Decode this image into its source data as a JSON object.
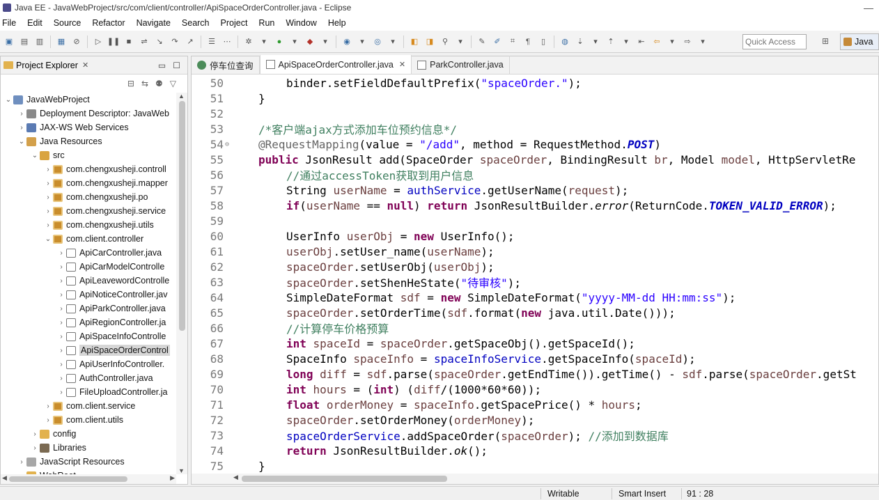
{
  "window": {
    "title": "Java EE - JavaWebProject/src/com/client/controller/ApiSpaceOrderController.java - Eclipse",
    "minimize": "—"
  },
  "menu": [
    "File",
    "Edit",
    "Source",
    "Refactor",
    "Navigate",
    "Search",
    "Project",
    "Run",
    "Window",
    "Help"
  ],
  "toolbar": {
    "quick_access_placeholder": "Quick Access",
    "perspective_label": "Java"
  },
  "explorer": {
    "tab_label": "Project Explorer",
    "tree": [
      {
        "label": "JavaWebProject",
        "twisty": "v",
        "icon": "project"
      },
      {
        "label": "Deployment Descriptor: JavaWeb",
        "twisty": ">",
        "icon": "descriptor"
      },
      {
        "label": "JAX-WS Web Services",
        "twisty": ">",
        "icon": "ws"
      },
      {
        "label": "Java Resources",
        "twisty": "v",
        "icon": "res"
      },
      {
        "label": "src",
        "twisty": "v",
        "icon": "src"
      },
      {
        "label": "com.chengxusheji.controll",
        "twisty": ">",
        "icon": "pkg"
      },
      {
        "label": "com.chengxusheji.mapper",
        "twisty": ">",
        "icon": "pkg"
      },
      {
        "label": "com.chengxusheji.po",
        "twisty": ">",
        "icon": "pkg"
      },
      {
        "label": "com.chengxusheji.service",
        "twisty": ">",
        "icon": "pkg"
      },
      {
        "label": "com.chengxusheji.utils",
        "twisty": ">",
        "icon": "pkg"
      },
      {
        "label": "com.client.controller",
        "twisty": "v",
        "icon": "pkg"
      },
      {
        "label": "ApiCarController.java",
        "twisty": ">",
        "icon": "java"
      },
      {
        "label": "ApiCarModelControlle",
        "twisty": ">",
        "icon": "java"
      },
      {
        "label": "ApiLeavewordControlle",
        "twisty": ">",
        "icon": "java"
      },
      {
        "label": "ApiNoticeController.jav",
        "twisty": ">",
        "icon": "java"
      },
      {
        "label": "ApiParkController.java",
        "twisty": ">",
        "icon": "java"
      },
      {
        "label": "ApiRegionController.ja",
        "twisty": ">",
        "icon": "java"
      },
      {
        "label": "ApiSpaceInfoControlle",
        "twisty": ">",
        "icon": "java"
      },
      {
        "label": "ApiSpaceOrderControl",
        "twisty": ">",
        "icon": "java",
        "selected": true
      },
      {
        "label": "ApiUserInfoController.",
        "twisty": ">",
        "icon": "java"
      },
      {
        "label": "AuthController.java",
        "twisty": ">",
        "icon": "java"
      },
      {
        "label": "FileUploadController.ja",
        "twisty": ">",
        "icon": "java"
      },
      {
        "label": "com.client.service",
        "twisty": ">",
        "icon": "pkg"
      },
      {
        "label": "com.client.utils",
        "twisty": ">",
        "icon": "pkg"
      },
      {
        "label": "config",
        "twisty": ">",
        "icon": "folder"
      },
      {
        "label": "Libraries",
        "twisty": ">",
        "icon": "lib"
      },
      {
        "label": "JavaScript Resources",
        "twisty": ">",
        "icon": "js"
      },
      {
        "label": "WebRoot",
        "twisty": "v",
        "icon": "folder"
      }
    ]
  },
  "editor": {
    "tabs": [
      {
        "label": "停车位查询",
        "icon": "globe",
        "active": false
      },
      {
        "label": "ApiSpaceOrderController.java",
        "icon": "jf",
        "active": true
      },
      {
        "label": "ParkController.java",
        "icon": "jf",
        "active": false
      }
    ],
    "lines": [
      {
        "n": "50",
        "indent": 2,
        "tokens": [
          [
            "binder.setFieldDefaultPrefix(",
            ""
          ],
          [
            "\"spaceOrder.\"",
            "str"
          ],
          [
            ");",
            ""
          ]
        ]
      },
      {
        "n": "51",
        "indent": 1,
        "tokens": [
          [
            "}",
            ""
          ]
        ]
      },
      {
        "n": "52",
        "indent": 0,
        "tokens": []
      },
      {
        "n": "53",
        "indent": 1,
        "tokens": [
          [
            "/*客户端ajax方式添加车位预约信息*/",
            "cm"
          ]
        ]
      },
      {
        "n": "54",
        "indent": 1,
        "fold": true,
        "tokens": [
          [
            "@RequestMapping",
            "ann"
          ],
          [
            "(value = ",
            ""
          ],
          [
            "\"/add\"",
            "str"
          ],
          [
            ", method = RequestMethod.",
            ""
          ],
          [
            "POST",
            "bfld"
          ],
          [
            ")",
            ""
          ]
        ]
      },
      {
        "n": "55",
        "indent": 1,
        "tokens": [
          [
            "public",
            "kw"
          ],
          [
            " JsonResult add(SpaceOrder ",
            ""
          ],
          [
            "spaceOrder",
            "var"
          ],
          [
            ", BindingResult ",
            ""
          ],
          [
            "br",
            "var"
          ],
          [
            ", Model ",
            ""
          ],
          [
            "model",
            "var"
          ],
          [
            ", HttpServletRe",
            ""
          ]
        ]
      },
      {
        "n": "56",
        "indent": 2,
        "tokens": [
          [
            "//通过accessToken获取到用户信息",
            "cm"
          ]
        ]
      },
      {
        "n": "57",
        "indent": 2,
        "tokens": [
          [
            "String ",
            ""
          ],
          [
            "userName",
            "var"
          ],
          [
            " = ",
            ""
          ],
          [
            "authService",
            "fld"
          ],
          [
            ".getUserName(",
            ""
          ],
          [
            "request",
            "var"
          ],
          [
            ");",
            ""
          ]
        ]
      },
      {
        "n": "58",
        "indent": 2,
        "tokens": [
          [
            "if",
            "kw"
          ],
          [
            "(",
            ""
          ],
          [
            "userName",
            "var"
          ],
          [
            " == ",
            ""
          ],
          [
            "null",
            "kw"
          ],
          [
            ") ",
            ""
          ],
          [
            "return",
            "kw"
          ],
          [
            " JsonResultBuilder.",
            ""
          ],
          [
            "error",
            "it"
          ],
          [
            "(ReturnCode.",
            ""
          ],
          [
            "TOKEN_VALID_ERROR",
            "bfld"
          ],
          [
            ");",
            ""
          ]
        ]
      },
      {
        "n": "59",
        "indent": 0,
        "tokens": []
      },
      {
        "n": "60",
        "indent": 2,
        "tokens": [
          [
            "UserInfo ",
            ""
          ],
          [
            "userObj",
            "var"
          ],
          [
            " = ",
            ""
          ],
          [
            "new",
            "kw"
          ],
          [
            " UserInfo();",
            ""
          ]
        ]
      },
      {
        "n": "61",
        "indent": 2,
        "tokens": [
          [
            "userObj",
            "var"
          ],
          [
            ".setUser_name(",
            ""
          ],
          [
            "userName",
            "var"
          ],
          [
            ");",
            ""
          ]
        ]
      },
      {
        "n": "62",
        "indent": 2,
        "tokens": [
          [
            "spaceOrder",
            "var"
          ],
          [
            ".setUserObj(",
            ""
          ],
          [
            "userObj",
            "var"
          ],
          [
            ");",
            ""
          ]
        ]
      },
      {
        "n": "63",
        "indent": 2,
        "tokens": [
          [
            "spaceOrder",
            "var"
          ],
          [
            ".setShenHeState(",
            ""
          ],
          [
            "\"待审核\"",
            "str"
          ],
          [
            ");",
            ""
          ]
        ]
      },
      {
        "n": "64",
        "indent": 2,
        "tokens": [
          [
            "SimpleDateFormat ",
            ""
          ],
          [
            "sdf",
            "var"
          ],
          [
            " = ",
            ""
          ],
          [
            "new",
            "kw"
          ],
          [
            " SimpleDateFormat(",
            ""
          ],
          [
            "\"yyyy-MM-dd HH:mm:ss\"",
            "str"
          ],
          [
            ");",
            ""
          ]
        ]
      },
      {
        "n": "65",
        "indent": 2,
        "tokens": [
          [
            "spaceOrder",
            "var"
          ],
          [
            ".setOrderTime(",
            ""
          ],
          [
            "sdf",
            "var"
          ],
          [
            ".format(",
            ""
          ],
          [
            "new",
            "kw"
          ],
          [
            " java.util.Date()));",
            ""
          ]
        ]
      },
      {
        "n": "66",
        "indent": 2,
        "tokens": [
          [
            "//计算停车价格预算",
            "cm"
          ]
        ]
      },
      {
        "n": "67",
        "indent": 2,
        "tokens": [
          [
            "int",
            "kw"
          ],
          [
            " ",
            ""
          ],
          [
            "spaceId",
            "var"
          ],
          [
            " = ",
            ""
          ],
          [
            "spaceOrder",
            "var"
          ],
          [
            ".getSpaceObj().getSpaceId();",
            ""
          ]
        ]
      },
      {
        "n": "68",
        "indent": 2,
        "tokens": [
          [
            "SpaceInfo ",
            ""
          ],
          [
            "spaceInfo",
            "var"
          ],
          [
            " = ",
            ""
          ],
          [
            "spaceInfoService",
            "fld"
          ],
          [
            ".getSpaceInfo(",
            ""
          ],
          [
            "spaceId",
            "var"
          ],
          [
            ");",
            ""
          ]
        ]
      },
      {
        "n": "69",
        "indent": 2,
        "tokens": [
          [
            "long",
            "kw"
          ],
          [
            " ",
            ""
          ],
          [
            "diff",
            "var"
          ],
          [
            " = ",
            ""
          ],
          [
            "sdf",
            "var"
          ],
          [
            ".parse(",
            ""
          ],
          [
            "spaceOrder",
            "var"
          ],
          [
            ".getEndTime()).getTime() - ",
            ""
          ],
          [
            "sdf",
            "var"
          ],
          [
            ".parse(",
            ""
          ],
          [
            "spaceOrder",
            "var"
          ],
          [
            ".getSt",
            ""
          ]
        ]
      },
      {
        "n": "70",
        "indent": 2,
        "tokens": [
          [
            "int",
            "kw"
          ],
          [
            " ",
            ""
          ],
          [
            "hours",
            "var"
          ],
          [
            " = (",
            ""
          ],
          [
            "int",
            "kw"
          ],
          [
            ") (",
            ""
          ],
          [
            "diff",
            "var"
          ],
          [
            "/(1000*60*60));",
            ""
          ]
        ]
      },
      {
        "n": "71",
        "indent": 2,
        "tokens": [
          [
            "float",
            "kw"
          ],
          [
            " ",
            ""
          ],
          [
            "orderMoney",
            "var"
          ],
          [
            " = ",
            ""
          ],
          [
            "spaceInfo",
            "var"
          ],
          [
            ".getSpacePrice() * ",
            ""
          ],
          [
            "hours",
            "var"
          ],
          [
            ";",
            ""
          ]
        ]
      },
      {
        "n": "72",
        "indent": 2,
        "tokens": [
          [
            "spaceOrder",
            "var"
          ],
          [
            ".setOrderMoney(",
            ""
          ],
          [
            "orderMoney",
            "var"
          ],
          [
            ");",
            ""
          ]
        ]
      },
      {
        "n": "73",
        "indent": 2,
        "tokens": [
          [
            "spaceOrderService",
            "fld"
          ],
          [
            ".addSpaceOrder(",
            ""
          ],
          [
            "spaceOrder",
            "var"
          ],
          [
            "); ",
            ""
          ],
          [
            "//添加到数据库",
            "cm"
          ]
        ]
      },
      {
        "n": "74",
        "indent": 2,
        "tokens": [
          [
            "return",
            "kw"
          ],
          [
            " JsonResultBuilder.",
            ""
          ],
          [
            "ok",
            "it"
          ],
          [
            "();",
            ""
          ]
        ]
      },
      {
        "n": "75",
        "indent": 1,
        "tokens": [
          [
            "}",
            ""
          ]
        ]
      }
    ]
  },
  "status": {
    "writable": "Writable",
    "insert_mode": "Smart Insert",
    "position": "91 : 28"
  }
}
